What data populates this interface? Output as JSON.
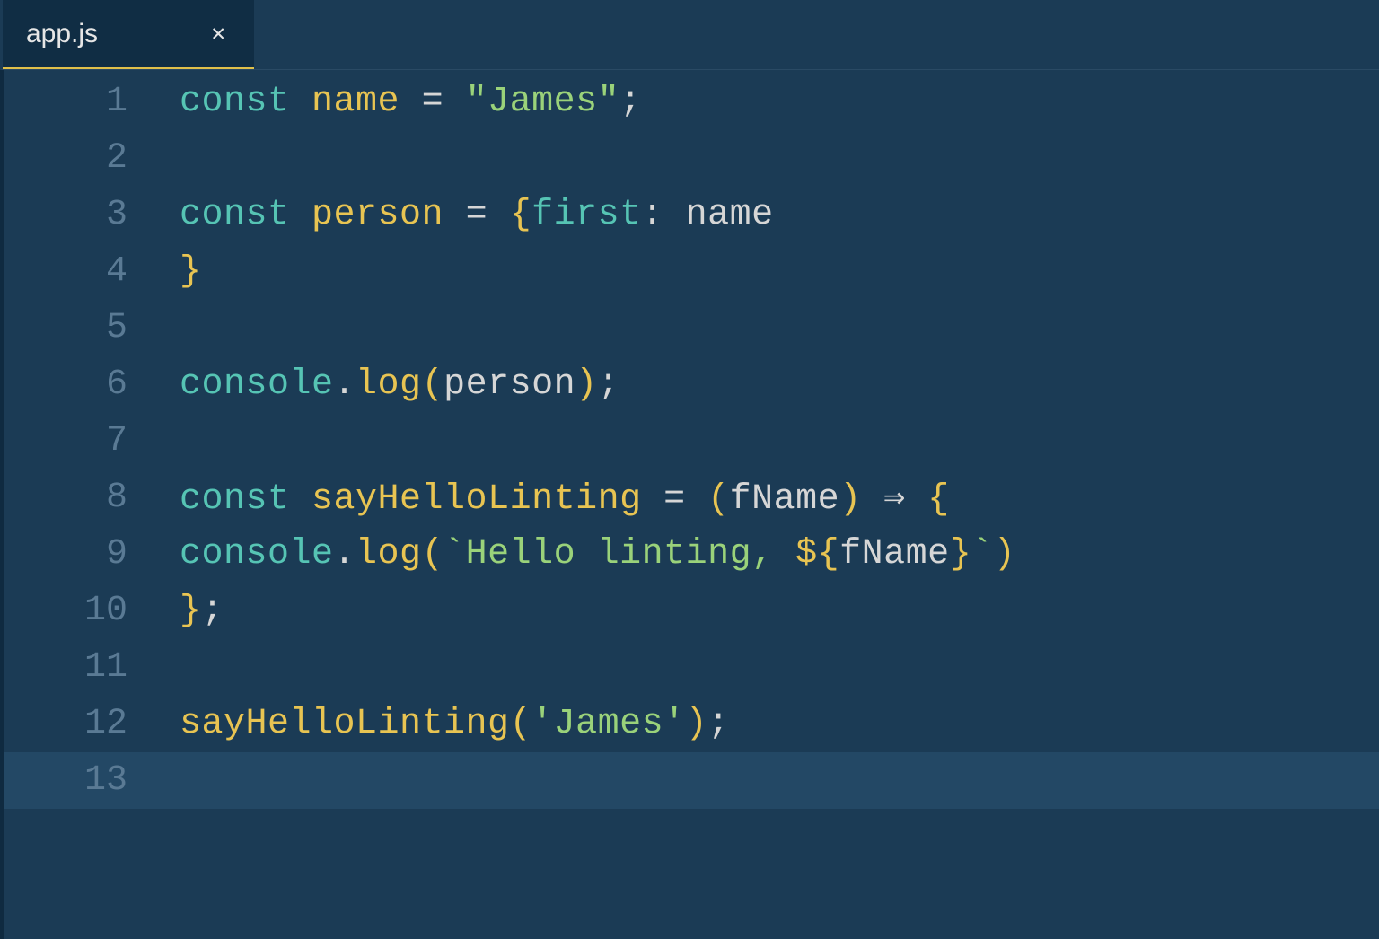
{
  "tabs": [
    {
      "label": "app.js",
      "active": true
    }
  ],
  "editor": {
    "filename": "app.js",
    "language": "javascript",
    "current_line": 13,
    "lines": [
      {
        "n": 1,
        "tokens": [
          {
            "t": "const ",
            "c": "kw"
          },
          {
            "t": "name ",
            "c": "var"
          },
          {
            "t": "= ",
            "c": "op"
          },
          {
            "t": "\"James\"",
            "c": "str"
          },
          {
            "t": ";",
            "c": "punct"
          }
        ]
      },
      {
        "n": 2,
        "tokens": []
      },
      {
        "n": 3,
        "tokens": [
          {
            "t": "const ",
            "c": "kw"
          },
          {
            "t": "person ",
            "c": "var"
          },
          {
            "t": "= ",
            "c": "op"
          },
          {
            "t": "{",
            "c": "brace"
          },
          {
            "t": "first",
            "c": "prop"
          },
          {
            "t": ": ",
            "c": "punct"
          },
          {
            "t": "name",
            "c": "ident"
          }
        ]
      },
      {
        "n": 4,
        "tokens": [
          {
            "t": "}",
            "c": "brace"
          }
        ]
      },
      {
        "n": 5,
        "tokens": []
      },
      {
        "n": 6,
        "tokens": [
          {
            "t": "console",
            "c": "obj"
          },
          {
            "t": ".",
            "c": "punct"
          },
          {
            "t": "log",
            "c": "fn"
          },
          {
            "t": "(",
            "c": "brace"
          },
          {
            "t": "person",
            "c": "ident"
          },
          {
            "t": ")",
            "c": "brace"
          },
          {
            "t": ";",
            "c": "punct"
          }
        ]
      },
      {
        "n": 7,
        "tokens": []
      },
      {
        "n": 8,
        "tokens": [
          {
            "t": "const ",
            "c": "kw"
          },
          {
            "t": "sayHelloLinting ",
            "c": "fn"
          },
          {
            "t": "= ",
            "c": "op"
          },
          {
            "t": "(",
            "c": "brace"
          },
          {
            "t": "fName",
            "c": "ident"
          },
          {
            "t": ") ",
            "c": "brace"
          },
          {
            "t": "⇒ ",
            "c": "arrow"
          },
          {
            "t": "{",
            "c": "brace"
          }
        ]
      },
      {
        "n": 9,
        "tokens": [
          {
            "t": "console",
            "c": "obj"
          },
          {
            "t": ".",
            "c": "punct"
          },
          {
            "t": "log",
            "c": "fn"
          },
          {
            "t": "(",
            "c": "brace"
          },
          {
            "t": "`Hello linting, ",
            "c": "tmpl"
          },
          {
            "t": "${",
            "c": "interp-brace"
          },
          {
            "t": "fName",
            "c": "ident"
          },
          {
            "t": "}",
            "c": "interp-brace"
          },
          {
            "t": "`",
            "c": "tmpl"
          },
          {
            "t": ")",
            "c": "brace"
          }
        ]
      },
      {
        "n": 10,
        "tokens": [
          {
            "t": "}",
            "c": "brace"
          },
          {
            "t": ";",
            "c": "punct"
          }
        ]
      },
      {
        "n": 11,
        "tokens": []
      },
      {
        "n": 12,
        "tokens": [
          {
            "t": "sayHelloLinting",
            "c": "fn"
          },
          {
            "t": "(",
            "c": "brace"
          },
          {
            "t": "'James'",
            "c": "str"
          },
          {
            "t": ")",
            "c": "brace"
          },
          {
            "t": ";",
            "c": "punct"
          }
        ]
      },
      {
        "n": 13,
        "tokens": []
      }
    ]
  },
  "colors": {
    "background": "#1b3b55",
    "tab_bg": "#102d44",
    "tab_underline": "#e0c04a",
    "gutter_fg": "#5a7a94",
    "current_line_bg": "#234865",
    "keyword": "#56c4b4",
    "string": "#9ad27a",
    "function": "#e8c452",
    "default": "#d6d6d6"
  }
}
